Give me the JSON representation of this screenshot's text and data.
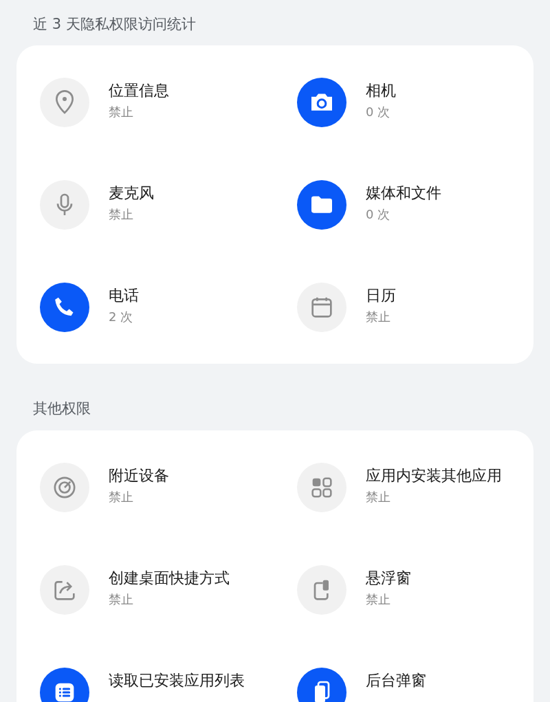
{
  "sections": [
    {
      "title": "近 3 天隐私权限访问统计",
      "items": [
        {
          "name": "位置信息",
          "status": "禁止",
          "active": false
        },
        {
          "name": "相机",
          "status": "0 次",
          "active": true
        },
        {
          "name": "麦克风",
          "status": "禁止",
          "active": false
        },
        {
          "name": "媒体和文件",
          "status": "0 次",
          "active": true
        },
        {
          "name": "电话",
          "status": "2 次",
          "active": true
        },
        {
          "name": "日历",
          "status": "禁止",
          "active": false
        }
      ]
    },
    {
      "title": "其他权限",
      "items": [
        {
          "name": "附近设备",
          "status": "禁止",
          "active": false
        },
        {
          "name": "应用内安装其他应用",
          "status": "禁止",
          "active": false
        },
        {
          "name": "创建桌面快捷方式",
          "status": "禁止",
          "active": false
        },
        {
          "name": "悬浮窗",
          "status": "禁止",
          "active": false
        },
        {
          "name": "读取已安装应用列表",
          "active": true
        },
        {
          "name": "后台弹窗",
          "active": true
        }
      ]
    }
  ]
}
